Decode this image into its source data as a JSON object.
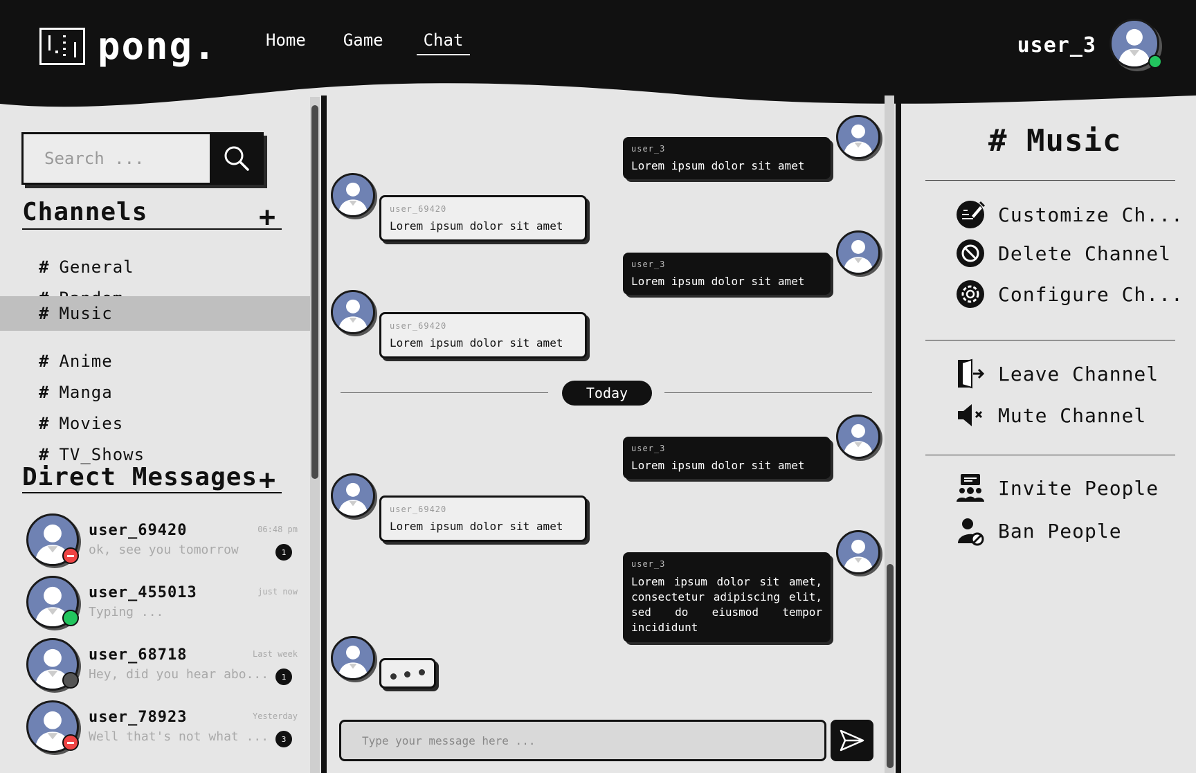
{
  "app": {
    "logo_text": "pong.",
    "colors": {
      "dark": "#111111",
      "background": "#e6e6e6",
      "avatar": "#6f82b3",
      "online": "#22c55e",
      "busy": "#ef4444",
      "offline": "#555555"
    }
  },
  "nav": {
    "items": [
      {
        "label": "Home"
      },
      {
        "label": "Game"
      },
      {
        "label": "Chat",
        "active": true
      }
    ]
  },
  "current_user": {
    "name": "user_3",
    "status": "online"
  },
  "search": {
    "placeholder": "Search ..."
  },
  "channels": {
    "title": "Channels",
    "add_icon": "plus-icon",
    "items": [
      {
        "label": "General"
      },
      {
        "label": "Random"
      },
      {
        "label": "Music",
        "active": true
      },
      {
        "label": "Anime"
      },
      {
        "label": "Manga"
      },
      {
        "label": "Movies"
      },
      {
        "label": "TV_Shows"
      }
    ]
  },
  "direct_messages": {
    "title": "Direct Messages",
    "items": [
      {
        "name": "user_69420",
        "preview": "ok, see you tomorrow",
        "time": "06:48 pm",
        "unread": "1",
        "status": "busy"
      },
      {
        "name": "user_455013",
        "preview": "Typing ...",
        "time": "just now",
        "unread": "",
        "status": "online"
      },
      {
        "name": "user_68718",
        "preview": "Hey, did you hear abo...",
        "time": "Last week",
        "unread": "1",
        "status": "offline"
      },
      {
        "name": "user_78923",
        "preview": "Well that's not what ...",
        "time": "Yesterday",
        "unread": "3",
        "status": "busy"
      }
    ]
  },
  "chat": {
    "messages": [
      {
        "sender": "user_3",
        "text": "Lorem ipsum dolor sit amet",
        "mine": true
      },
      {
        "sender": "user_69420",
        "text": "Lorem ipsum dolor sit amet",
        "mine": false
      },
      {
        "sender": "user_3",
        "text": "Lorem ipsum dolor sit amet",
        "mine": true
      },
      {
        "sender": "user_69420",
        "text": "Lorem ipsum dolor sit amet",
        "mine": false
      },
      {
        "sender": "user_3",
        "text": "Lorem ipsum dolor sit amet",
        "mine": true
      },
      {
        "sender": "user_69420",
        "text": "Lorem ipsum dolor sit amet",
        "mine": false
      },
      {
        "sender": "user_3",
        "text": "Lorem ipsum dolor sit amet, consectetur adipiscing elit, sed do eiusmod tempor incididunt",
        "mine": true
      }
    ],
    "date_separator": "Today",
    "input_placeholder": "Type your message here ..."
  },
  "channel_panel": {
    "title": "# Music",
    "actions": [
      {
        "label": "Customize Ch...",
        "icon": "edit-signature-icon"
      },
      {
        "label": "Delete Channel",
        "icon": "ban-icon"
      },
      {
        "label": "Configure Ch...",
        "icon": "gear-icon"
      },
      {
        "label": "Leave Channel",
        "icon": "exit-door-icon"
      },
      {
        "label": "Mute Channel",
        "icon": "speaker-mute-icon"
      },
      {
        "label": "Invite People",
        "icon": "invite-people-icon"
      },
      {
        "label": "Ban People",
        "icon": "ban-user-icon"
      }
    ]
  }
}
